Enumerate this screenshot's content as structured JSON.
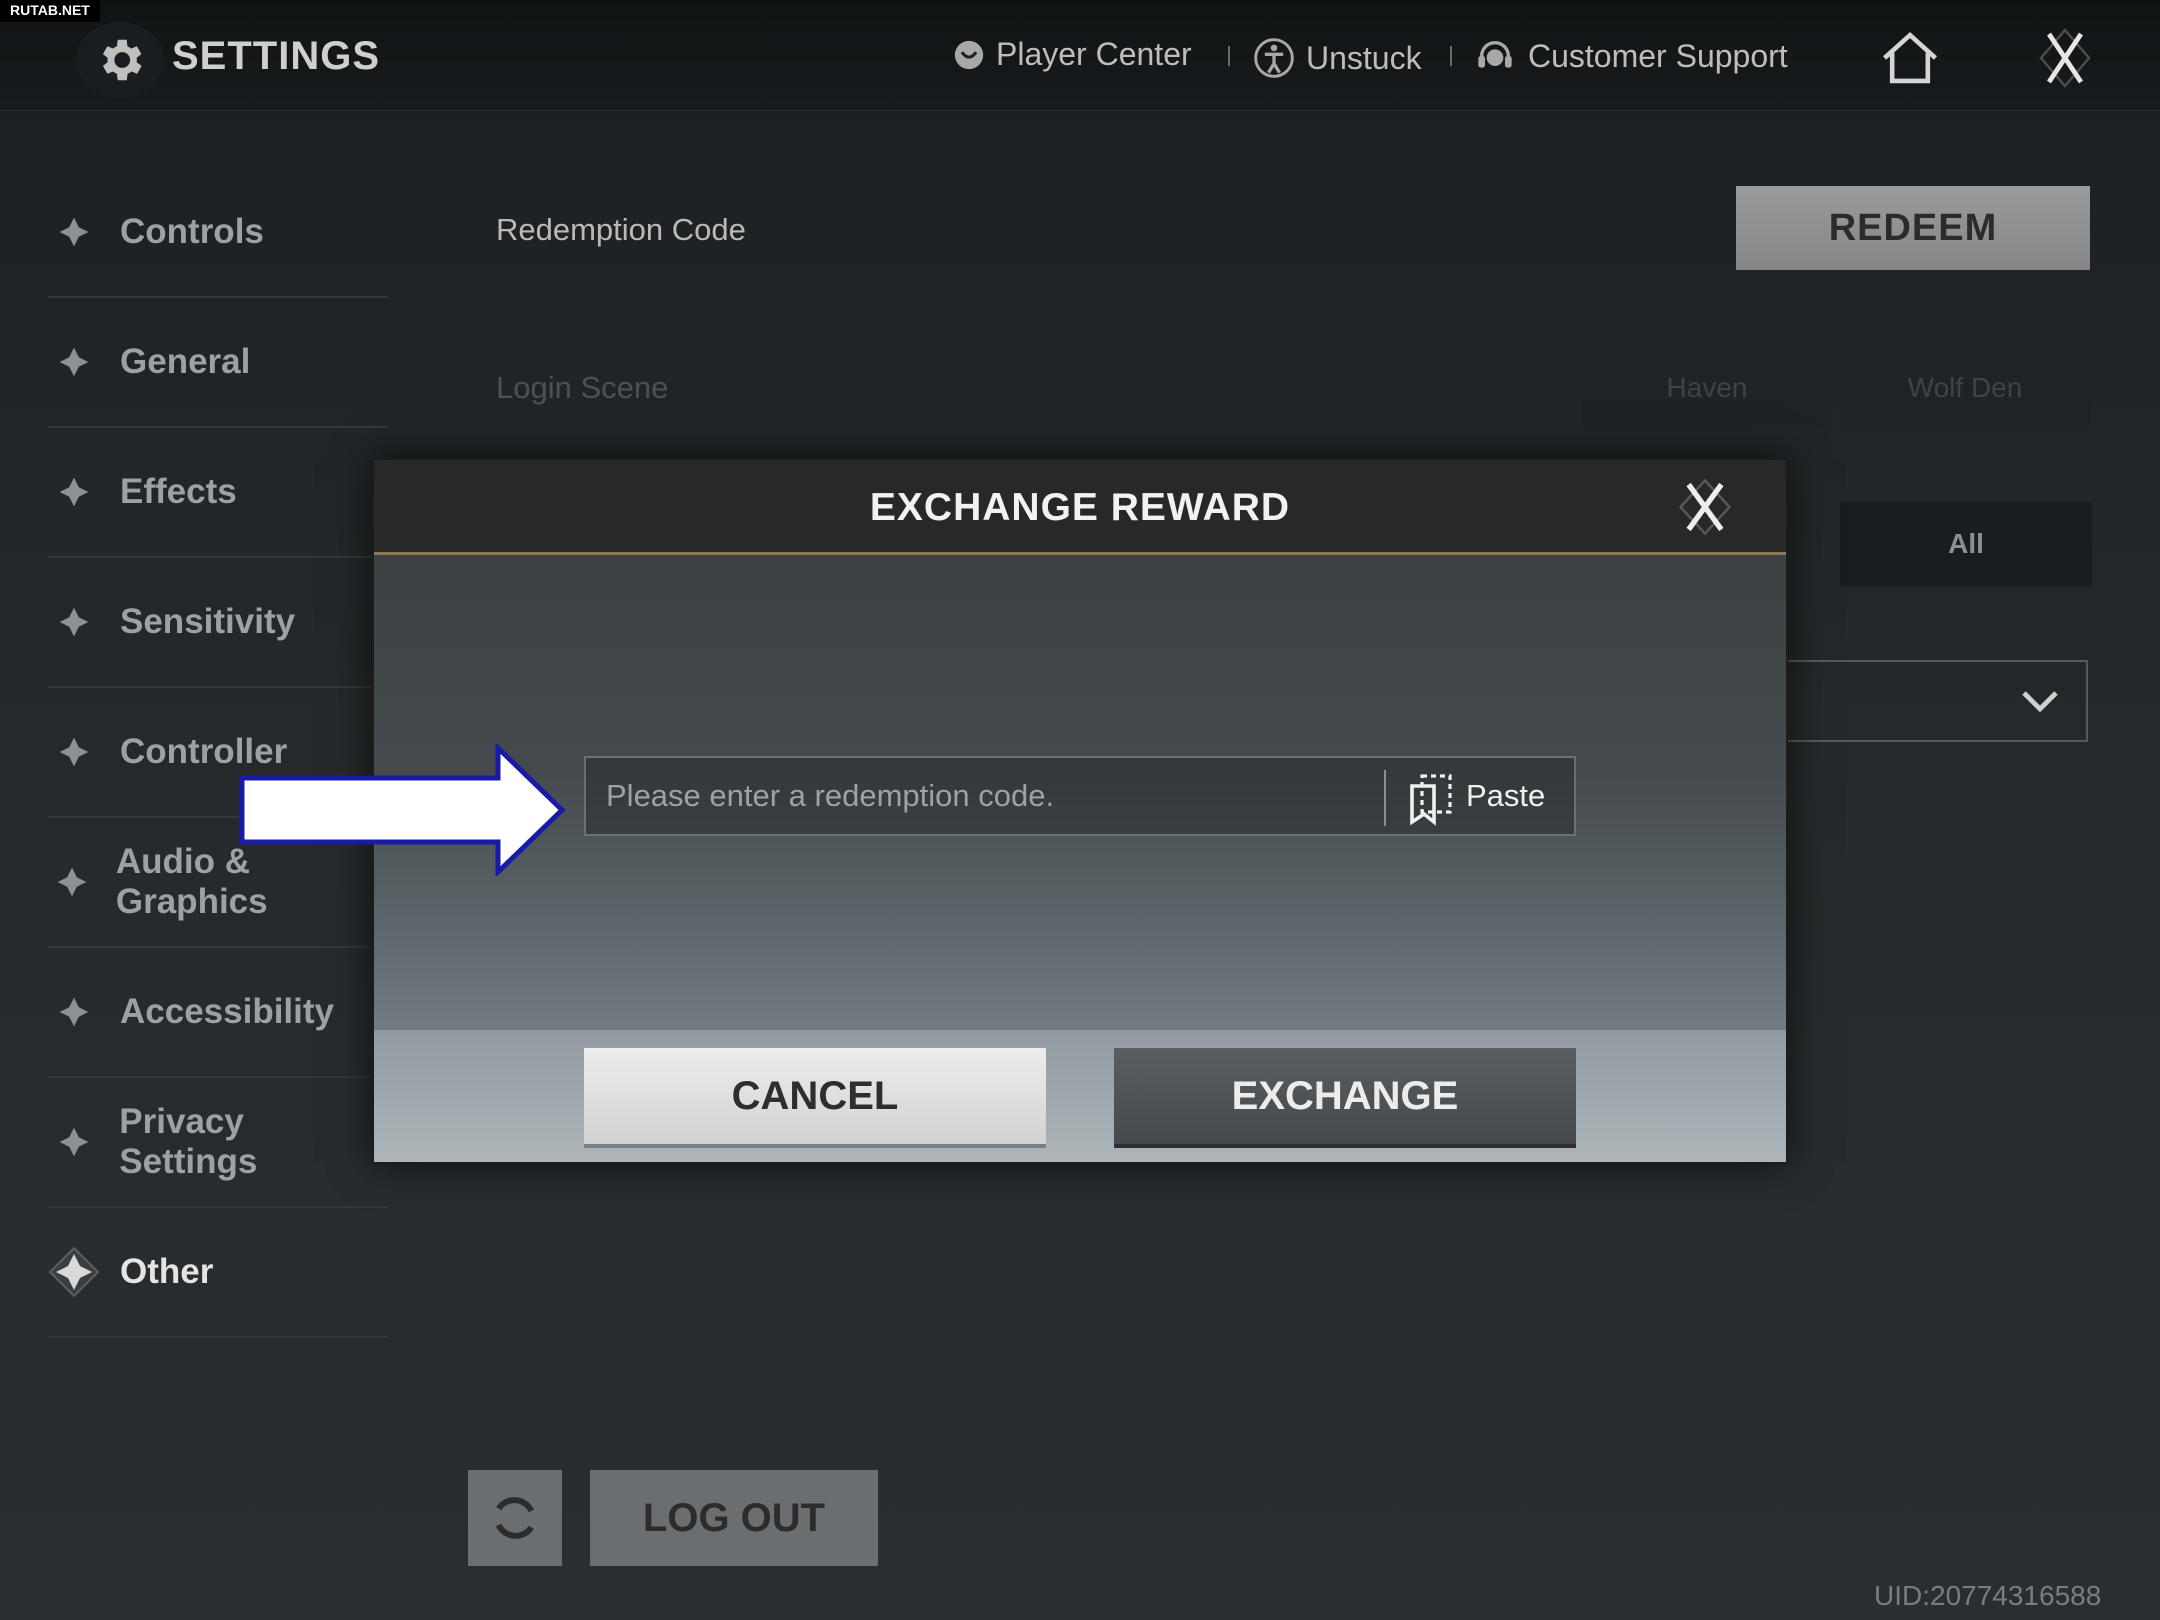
{
  "watermark": "RUTAB.NET",
  "header": {
    "title": "SETTINGS",
    "links": [
      {
        "label": "Player Center",
        "icon": "player-center-icon"
      },
      {
        "label": "Unstuck",
        "icon": "unstuck-icon"
      },
      {
        "label": "Customer Support",
        "icon": "headset-icon"
      }
    ],
    "home_icon": "home-icon",
    "close_icon": "close-icon"
  },
  "sidebar": {
    "items": [
      {
        "label": "Controls",
        "active": false
      },
      {
        "label": "General",
        "active": false
      },
      {
        "label": "Effects",
        "active": false
      },
      {
        "label": "Sensitivity",
        "active": false
      },
      {
        "label": "Controller",
        "active": false
      },
      {
        "label": "Audio & Graphics",
        "active": false
      },
      {
        "label": "Accessibility",
        "active": false
      },
      {
        "label": "Privacy Settings",
        "active": false
      },
      {
        "label": "Other",
        "active": true
      }
    ]
  },
  "main": {
    "redemption_label": "Redemption Code",
    "redeem_button": "REDEEM",
    "login_scene_label": "Login Scene",
    "login_scene_options": [
      "Haven",
      "Wolf Den"
    ],
    "all_option": "All",
    "logout_button": "LOG OUT",
    "uid": "UID:20774316588"
  },
  "modal": {
    "title": "EXCHANGE REWARD",
    "input_placeholder": "Please enter a redemption code.",
    "paste_label": "Paste",
    "cancel_button": "CANCEL",
    "exchange_button": "EXCHANGE"
  },
  "colors": {
    "accent_gold": "#8a7a55",
    "arrow_fill": "#ffffff",
    "arrow_outline": "#1a1aa8"
  }
}
